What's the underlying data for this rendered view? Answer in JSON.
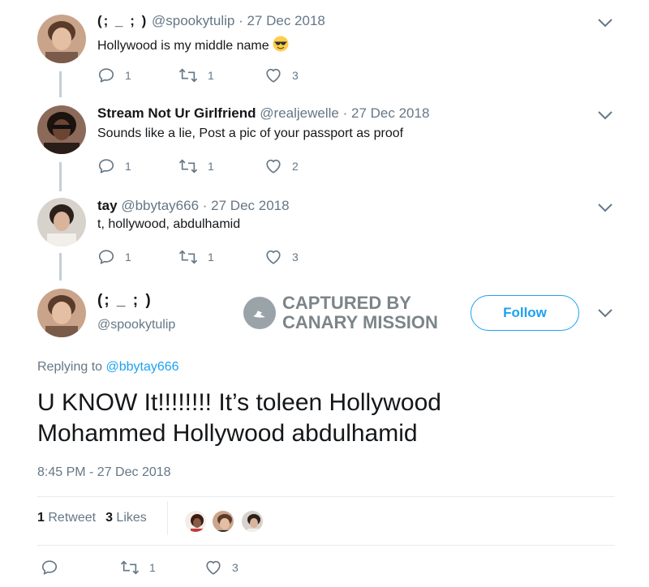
{
  "replies": [
    {
      "name": "(; _ ; )",
      "handle": "@spookytulip",
      "sep": "·",
      "date": "27 Dec 2018",
      "text": "Hollywood is my middle name",
      "emoji": "sunglasses-emoji",
      "reply_count": "1",
      "retweet_count": "1",
      "like_count": "3"
    },
    {
      "name": "Stream Not Ur Girlfriend",
      "handle": "@realjewelle",
      "sep": "·",
      "date": "27 Dec 2018",
      "text": "Sounds like a lie, Post a pic of your passport as proof",
      "reply_count": "1",
      "retweet_count": "1",
      "like_count": "2"
    },
    {
      "name": "tay",
      "handle": "@bbytay666",
      "sep": "·",
      "date": "27 Dec 2018",
      "text": "t, hollywood, abdulhamid",
      "reply_count": "1",
      "retweet_count": "1",
      "like_count": "3"
    }
  ],
  "main_tweet": {
    "name": "(; _ ; )",
    "handle": "@spookytulip",
    "follow_label": "Follow",
    "replying_prefix": "Replying to",
    "replying_handle": "@bbytay666",
    "text_line1": "U KNOW It!!!!!!!! It’s toleen Hollywood",
    "text_line2": "Mohammed Hollywood abdulhamid",
    "timestamp": "8:45 PM - 27 Dec 2018",
    "retweets_count": "1",
    "retweets_label": "Retweet",
    "likes_count": "3",
    "likes_label": "Likes",
    "reply_count": "",
    "retweet_count": "1",
    "like_count": "3"
  },
  "watermark": {
    "line1": "CAPTURED BY",
    "line2": "CANARY MISSION"
  },
  "colors": {
    "accent": "#1da1f2",
    "secondary_text": "#657786",
    "primary_text": "#14171a",
    "thread_line": "#c4cfd6"
  },
  "icons": [
    "reply-icon",
    "retweet-icon",
    "like-icon",
    "chevron-down-icon",
    "canary-logo-icon"
  ]
}
